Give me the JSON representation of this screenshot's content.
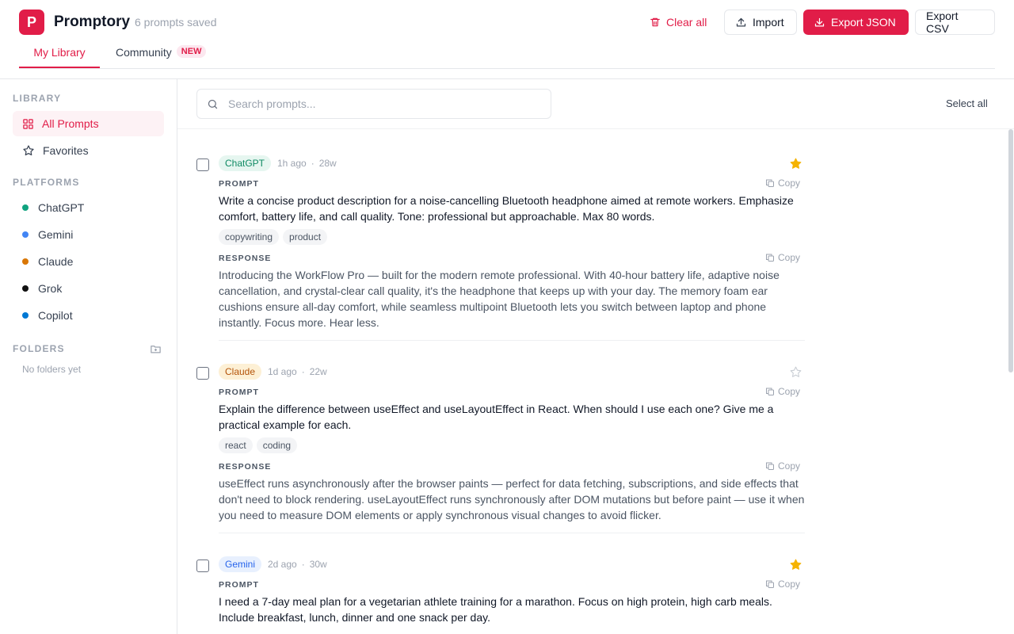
{
  "app": {
    "logo_letter": "P",
    "title": "Promptory",
    "saved_count": "6 prompts saved"
  },
  "header": {
    "clear_all": "Clear all",
    "import": "Import",
    "export_json": "Export JSON",
    "export_csv": "Export CSV"
  },
  "tabs": {
    "library": "My Library",
    "community": "Community",
    "community_badge": "NEW"
  },
  "sidebar": {
    "library_label": "LIBRARY",
    "all_prompts": "All Prompts",
    "favorites": "Favorites",
    "platforms_label": "PLATFORMS",
    "platforms": [
      {
        "name": "ChatGPT",
        "color": "#10a37f"
      },
      {
        "name": "Gemini",
        "color": "#4285f4"
      },
      {
        "name": "Claude",
        "color": "#d97706"
      },
      {
        "name": "Grok",
        "color": "#111111"
      },
      {
        "name": "Copilot",
        "color": "#0078d4"
      }
    ],
    "folders_label": "FOLDERS",
    "no_folders": "No folders yet"
  },
  "toolbar": {
    "search_placeholder": "Search prompts...",
    "select_all": "Select all"
  },
  "labels": {
    "prompt": "PROMPT",
    "response": "RESPONSE",
    "copy": "Copy"
  },
  "prompts": [
    {
      "platform": "ChatGPT",
      "time": "1h ago",
      "words": "28w",
      "favorite": true,
      "prompt": "Write a concise product description for a noise-cancelling Bluetooth headphone aimed at remote workers. Emphasize comfort, battery life, and call quality. Tone: professional but approachable. Max 80 words.",
      "tags": [
        "copywriting",
        "product"
      ],
      "response": "Introducing the WorkFlow Pro — built for the modern remote professional. With 40-hour battery life, adaptive noise cancellation, and crystal-clear call quality, it's the headphone that keeps up with your day. The memory foam ear cushions ensure all-day comfort, while seamless multipoint Bluetooth lets you switch between laptop and phone instantly. Focus more. Hear less."
    },
    {
      "platform": "Claude",
      "time": "1d ago",
      "words": "22w",
      "favorite": false,
      "prompt": "Explain the difference between useEffect and useLayoutEffect in React. When should I use each one? Give me a practical example for each.",
      "tags": [
        "react",
        "coding"
      ],
      "response": "useEffect runs asynchronously after the browser paints — perfect for data fetching, subscriptions, and side effects that don't need to block rendering. useLayoutEffect runs synchronously after DOM mutations but before paint — use it when you need to measure DOM elements or apply synchronous visual changes to avoid flicker."
    },
    {
      "platform": "Gemini",
      "time": "2d ago",
      "words": "30w",
      "favorite": true,
      "prompt": "I need a 7-day meal plan for a vegetarian athlete training for a marathon. Focus on high protein, high carb meals. Include breakfast, lunch, dinner and one snack per day."
    }
  ],
  "colors": {
    "accent": "#e11d48",
    "star": "#f5b301",
    "chatgpt_tag_bg": "#e6f6f0",
    "chatgpt_tag_fg": "#0f8a63",
    "claude_tag_bg": "#fdf0d5",
    "claude_tag_fg": "#b45309",
    "gemini_tag_bg": "#e8f0fe",
    "gemini_tag_fg": "#2563eb"
  }
}
